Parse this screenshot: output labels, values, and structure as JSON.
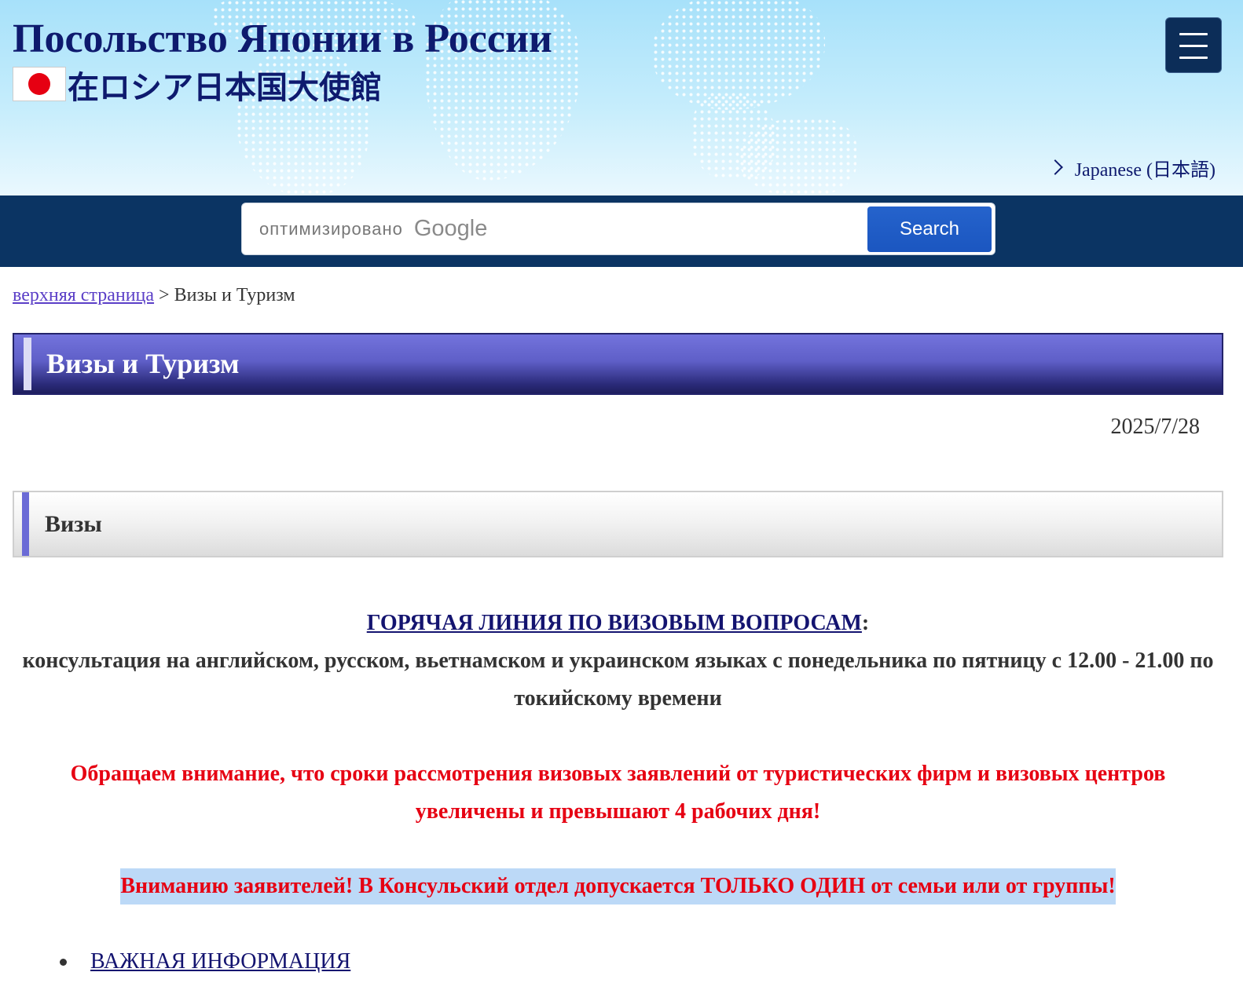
{
  "header": {
    "title_ru": "Посольство Японии в России",
    "title_ja": "在ロシア日本国大使館",
    "language_link": "Japanese (日本語)"
  },
  "icons": {
    "menu": "hamburger-menu-icon",
    "flag": "japan-flag-icon",
    "language_arrow": "chevron-right-icon"
  },
  "search": {
    "watermark_prefix": "оптимизировано",
    "watermark_brand": "Google",
    "button_label": "Search"
  },
  "breadcrumb": {
    "home_label": "верхняя страница",
    "separator": ">",
    "current": "Визы и Туризм"
  },
  "page": {
    "title": "Визы и Туризм",
    "date": "2025/7/28",
    "section_title": "Визы"
  },
  "content": {
    "hotline": {
      "link_label": "ГОРЯЧАЯ ЛИНИЯ ПО ВИЗОВЫМ ВОПРОСАМ",
      "colon": ":",
      "text": "консультация на английском, русском, вьетнамском и украинском языках с понедельника по пятницу с 12.00 - 21.00 по токийскому времени"
    },
    "notice": "Обращаем внимание, что сроки рассмотрения визовых заявлений от туристических фирм и визовых центров увеличены и превышают 4 рабочих дня!",
    "attention": "Вниманию заявителей! В Консульский отдел допускается ТОЛЬКО ОДИН от семьи или от группы!",
    "list": [
      {
        "label": "ВАЖНАЯ ИНФОРМАЦИЯ"
      }
    ]
  },
  "colors": {
    "header_navy": "#0e1a6e",
    "search_band": "#0b3463",
    "search_button": "#1b56c0",
    "heading_bar": "#5f5fc8",
    "accent_purple": "#6b6bd6",
    "alert_red": "#e60012",
    "highlight_blue": "#bcd9f7",
    "link_navy": "#141470",
    "visited_link": "#5b3fc7"
  }
}
